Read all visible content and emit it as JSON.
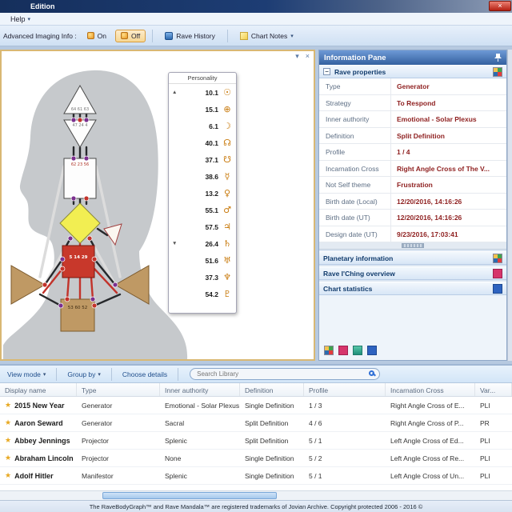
{
  "window": {
    "title": "Edition",
    "close_glyph": "×"
  },
  "menubar": {
    "help_label": "Help",
    "dropdown_glyph": "▾"
  },
  "toolbar": {
    "advanced_imaging_label": "Advanced Imaging Info :",
    "on_label": "On",
    "off_label": "Off",
    "rave_history_label": "Rave History",
    "chart_notes_label": "Chart Notes",
    "dropdown_glyph": "▾"
  },
  "chart_panel": {
    "collapse_glyph": "▾",
    "close_glyph": "×",
    "gate_labels": {
      "head": "64 61 63",
      "ajna": "47 24 4",
      "throat": "62 23 56",
      "sacral": "5 14 29",
      "root": "53 60 52"
    },
    "personality": {
      "title": "Personality",
      "rows": [
        {
          "expander": "▲",
          "value": "10.1",
          "planet": "☉"
        },
        {
          "value": "15.1",
          "planet": "⊕"
        },
        {
          "value": "6.1",
          "planet": "☽"
        },
        {
          "value": "40.1",
          "planet": "☊"
        },
        {
          "value": "37.1",
          "planet": "☋"
        },
        {
          "value": "38.6",
          "planet": "☿"
        },
        {
          "value": "13.2",
          "planet": "♀"
        },
        {
          "value": "55.1",
          "planet": "♂"
        },
        {
          "value": "57.5",
          "planet": "♃"
        },
        {
          "expander": "▼",
          "value": "26.4",
          "planet": "♄"
        },
        {
          "value": "51.6",
          "planet": "♅"
        },
        {
          "value": "37.3",
          "planet": "♆"
        },
        {
          "value": "54.2",
          "planet": "♇"
        }
      ]
    }
  },
  "info_pane": {
    "title": "Information Pane",
    "collapse_glyph": "−",
    "rave_properties_title": "Rave properties",
    "properties": [
      {
        "label": "Type",
        "value": "Generator"
      },
      {
        "label": "Strategy",
        "value": "To Respond"
      },
      {
        "label": "Inner authority",
        "value": "Emotional - Solar Plexus"
      },
      {
        "label": "Definition",
        "value": "Split Definition"
      },
      {
        "label": "Profile",
        "value": "1 / 4"
      },
      {
        "label": "Incarnation Cross",
        "value": "Right Angle Cross of The V..."
      },
      {
        "label": "Not Self theme",
        "value": "Frustration"
      },
      {
        "label": "Birth date (Local)",
        "value": "12/20/2016, 14:16:26"
      },
      {
        "label": "Birth date (UT)",
        "value": "12/20/2016, 14:16:26"
      },
      {
        "label": "Design date (UT)",
        "value": "9/23/2016, 17:03:41"
      }
    ],
    "collapsed_sections": [
      {
        "title": "Planetary information"
      },
      {
        "title": "Rave I'Ching overview"
      },
      {
        "title": "Chart statistics"
      }
    ]
  },
  "library": {
    "toolbar": {
      "view_mode_label": "View mode",
      "group_by_label": "Group by",
      "choose_details_label": "Choose details",
      "search_placeholder": "Search Library",
      "dropdown_glyph": "▾"
    },
    "star_glyph": "★",
    "columns": [
      "Display name",
      "Type",
      "Inner authority",
      "Definition",
      "Profile",
      "Incarnation Cross",
      "Var..."
    ],
    "rows": [
      {
        "cells": [
          "2015 New Year",
          "Generator",
          "Emotional - Solar Plexus",
          "Single Definition",
          "1 / 3",
          "Right Angle Cross of E...",
          "PLI"
        ]
      },
      {
        "cells": [
          "Aaron Seward",
          "Generator",
          "Sacral",
          "Split Definition",
          "4 / 6",
          "Right Angle Cross of P...",
          "PR"
        ]
      },
      {
        "cells": [
          "Abbey Jennings",
          "Projector",
          "Splenic",
          "Split Definition",
          "5 / 1",
          "Left Angle Cross of Ed...",
          "PLI"
        ]
      },
      {
        "cells": [
          "Abraham Lincoln",
          "Projector",
          "None",
          "Single Definition",
          "5 / 2",
          "Left Angle Cross of Re...",
          "PLI"
        ]
      },
      {
        "cells": [
          "Adolf Hitler",
          "Manifestor",
          "Splenic",
          "Single Definition",
          "5 / 1",
          "Left Angle Cross of Un...",
          "PLI"
        ]
      }
    ]
  },
  "statusbar": {
    "text": "The RaveBodyGraph™ and Rave Mandala™ are registered trademarks of Jovian Archive. Copyright protected 2006 - 2016 ©"
  }
}
